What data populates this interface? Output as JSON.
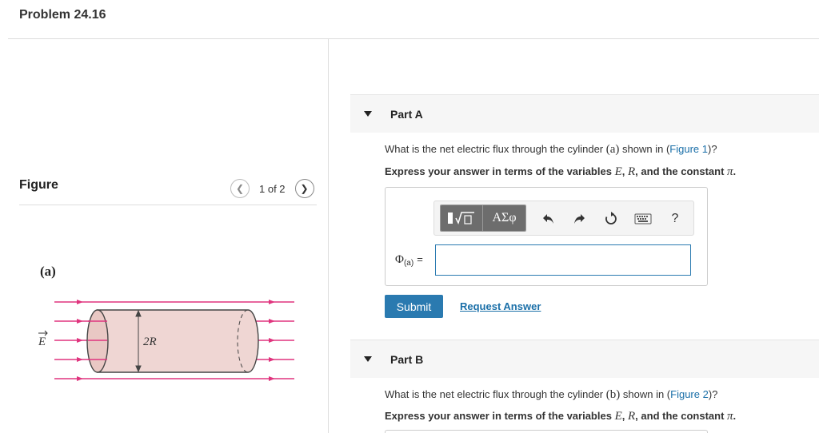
{
  "problem": {
    "title": "Problem 24.16"
  },
  "figure": {
    "heading": "Figure",
    "counter": "1 of 2",
    "prev_icon": "chevron-left-icon",
    "next_icon": "chevron-right-icon",
    "panel_label": "(a)",
    "field_label": "E",
    "diameter_label": "2R",
    "colors": {
      "field_lines": "#e0347e",
      "cylinder_fill": "#efd6d3",
      "cylinder_stroke": "#444444"
    }
  },
  "partA": {
    "label": "Part A",
    "question_pre": "What is the net electric flux through the cylinder",
    "question_var": "(a)",
    "question_mid": "shown in (",
    "question_link": "Figure 1",
    "question_post": ")?",
    "instr_pre": "Express your answer in terms of the variables",
    "instr_E": "E",
    "instr_comma": ",",
    "instr_R": "R",
    "instr_mid": ", and the constant",
    "instr_pi": "π",
    "instr_end": ".",
    "toolbar": {
      "template_icon": "templates-icon",
      "greek_label": "ΑΣφ",
      "undo_icon": "undo-icon",
      "redo_icon": "redo-icon",
      "reset_icon": "reset-icon",
      "keyboard_icon": "keyboard-icon",
      "help_label": "?"
    },
    "answer_symbol": "Φ",
    "answer_sub": "(a)",
    "answer_eq": "=",
    "answer_value": "",
    "submit_label": "Submit",
    "request_label": "Request Answer"
  },
  "partB": {
    "label": "Part B",
    "question_pre": "What is the net electric flux through the cylinder",
    "question_var": "(b)",
    "question_mid": "shown in (",
    "question_link": "Figure 2",
    "question_post": ")?",
    "instr_pre": "Express your answer in terms of the variables",
    "instr_E": "E",
    "instr_comma": ",",
    "instr_R": "R",
    "instr_mid": ", and the constant",
    "instr_pi": "π",
    "instr_end": "."
  },
  "colors": {
    "accent": "#2a7ab0",
    "link": "#1a6fa8",
    "toolbar_dark": "#6d6d6d"
  }
}
